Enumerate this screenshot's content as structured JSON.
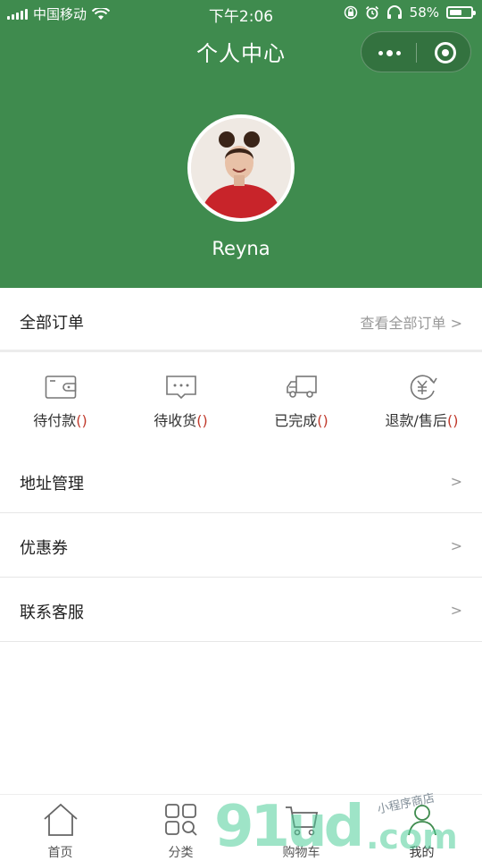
{
  "status_bar": {
    "carrier": "中国移动",
    "time": "下午2:06",
    "battery": "58%",
    "battery_level": 0.58
  },
  "nav": {
    "title": "个人中心"
  },
  "user": {
    "name": "Reyna"
  },
  "orders": {
    "label": "全部订单",
    "view_all": "查看全部订单 >"
  },
  "order_status": [
    {
      "label": "待付款",
      "count": "()",
      "icon": "wallet-icon"
    },
    {
      "label": "待收货",
      "count": "()",
      "icon": "message-box-icon"
    },
    {
      "label": "已完成",
      "count": "()",
      "icon": "truck-icon"
    },
    {
      "label": "退款/售后",
      "count": "()",
      "icon": "yen-refund-icon"
    }
  ],
  "menu": [
    {
      "label": "地址管理",
      "arrow": ">"
    },
    {
      "label": "优惠券",
      "arrow": ">"
    },
    {
      "label": "联系客服",
      "arrow": ">"
    }
  ],
  "tabbar": [
    {
      "label": "首页",
      "icon": "home-icon"
    },
    {
      "label": "分类",
      "icon": "category-icon"
    },
    {
      "label": "购物车",
      "icon": "cart-icon"
    },
    {
      "label": "我的",
      "icon": "user-icon"
    }
  ],
  "watermark": {
    "main": "91ud",
    "suffix": ".com",
    "small": "小程序商店"
  },
  "colors": {
    "brand_green": "#3f8b4e",
    "count_red": "#c0392b",
    "watermark": "#4fcf9a"
  }
}
